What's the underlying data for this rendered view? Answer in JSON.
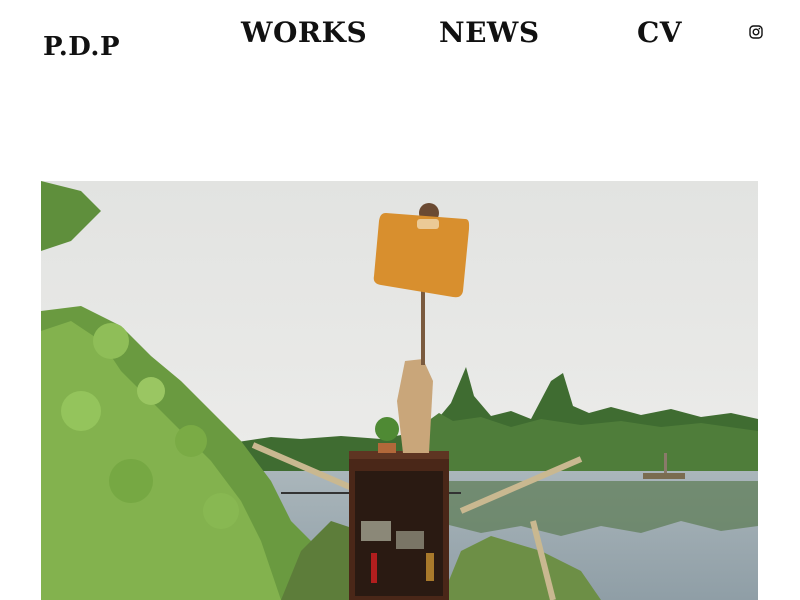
{
  "site": {
    "logo_text": "P.D.P"
  },
  "nav": {
    "items": [
      {
        "label": "WORKS"
      },
      {
        "label": "NEWS"
      },
      {
        "label": "CV"
      }
    ],
    "social_icon": "instagram-icon"
  },
  "hero": {
    "image_subject": "photo",
    "colors": {
      "sky": "#e6e7e5",
      "forest": "#3d6a2f",
      "water": "#9eadb5",
      "sign": "#d88f2e"
    }
  }
}
